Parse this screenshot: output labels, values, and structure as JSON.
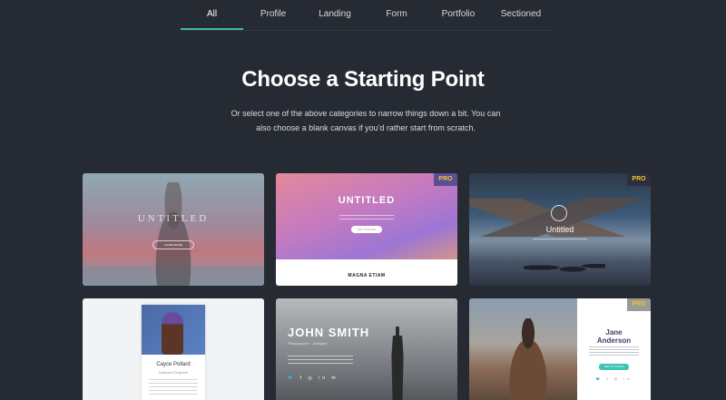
{
  "tabs": [
    {
      "label": "All",
      "active": true
    },
    {
      "label": "Profile"
    },
    {
      "label": "Landing"
    },
    {
      "label": "Form"
    },
    {
      "label": "Portfolio"
    },
    {
      "label": "Sectioned"
    }
  ],
  "accent_color": "#3fb5a7",
  "heading": {
    "title": "Choose a Starting Point",
    "subtitle": "Or select one of the above categories to narrow things down a bit. You can also choose a blank canvas if you'd rather start from scratch."
  },
  "badge": {
    "label": "PRO"
  },
  "templates": [
    {
      "title": "UNTITLED",
      "button": "LEARN MORE",
      "pro": false
    },
    {
      "title": "UNTITLED",
      "button": "GET STARTED",
      "footer": "MAGNA ETIAM",
      "pro": true
    },
    {
      "title": "Untitled",
      "pro": true
    },
    {
      "name": "Cayce Pollard",
      "role": "Software Engineer",
      "pro": false
    },
    {
      "title": "JOHN SMITH",
      "subtitle": "Photographer · Designer",
      "icons": "🐦 f ◎ in ✉",
      "pro": false
    },
    {
      "title_line1": "Jane",
      "title_line2": "Anderson",
      "button": "GET IN TOUCH",
      "social": "🐦 f ◎ in",
      "pro": true
    }
  ]
}
